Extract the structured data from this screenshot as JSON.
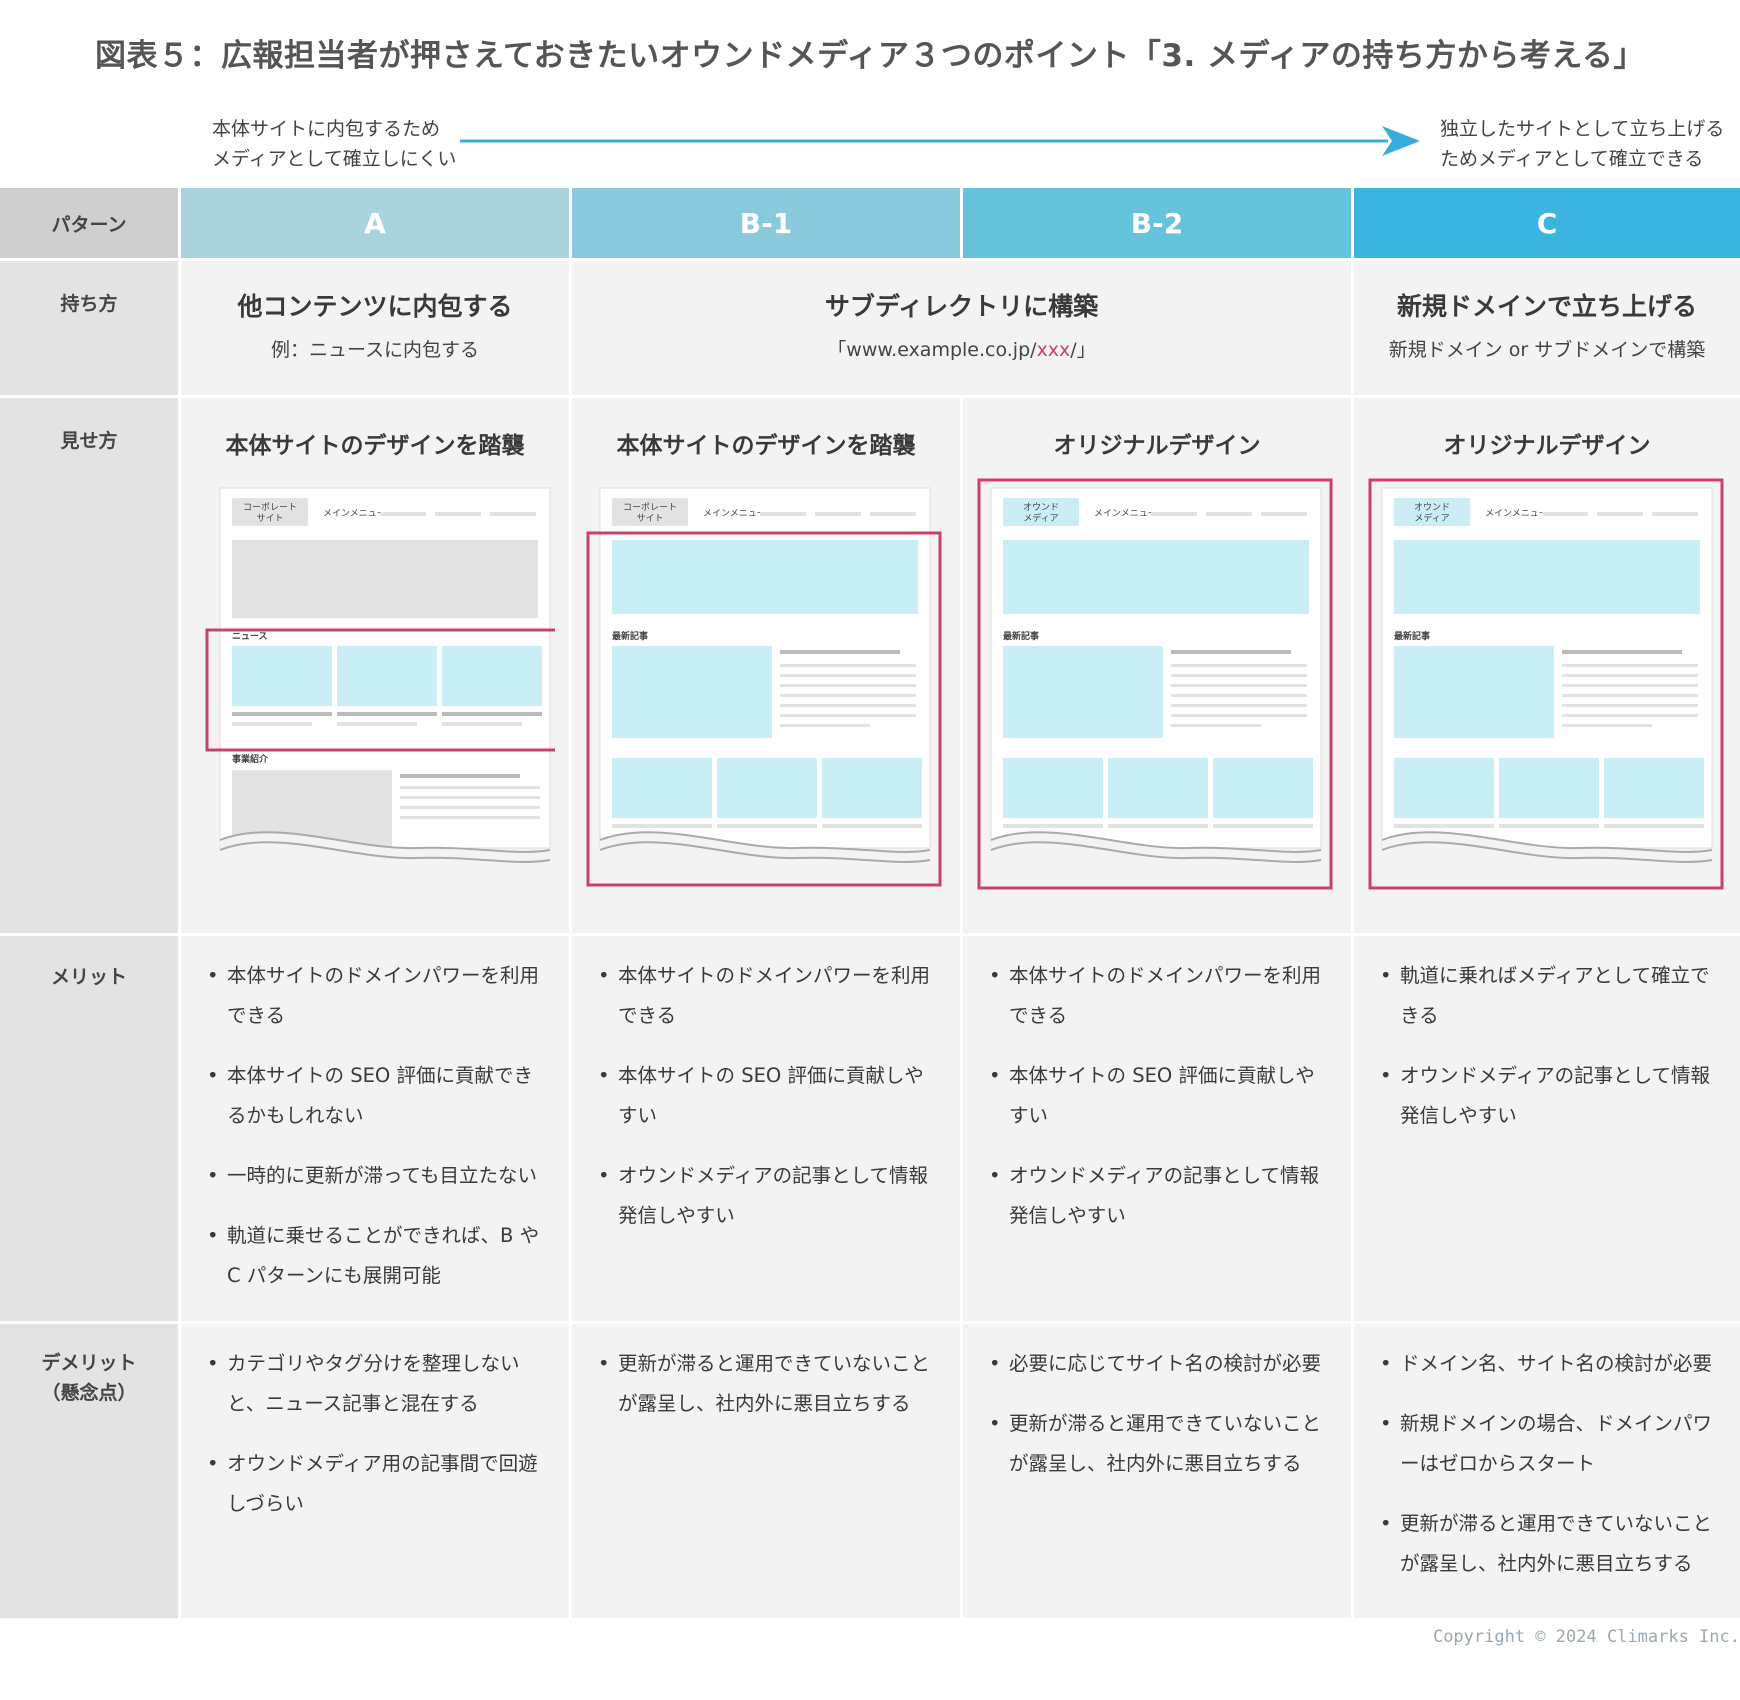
{
  "title": "図表５：広報担当者が押さえておきたいオウンドメディア３つのポイント「3. メディアの持ち方から考える」",
  "scale": {
    "left": [
      "本体サイトに内包するため",
      "メディアとして確立しにくい"
    ],
    "right": [
      "独立したサイトとして立ち上げる",
      "ためメディアとして確立できる"
    ]
  },
  "row_labels": {
    "pattern": "パターン",
    "holding": "持ち方",
    "appearance": "見せ方",
    "merit": "メリット",
    "demerit": [
      "デメリット",
      "（懸念点）"
    ]
  },
  "columns": [
    {
      "id": "A",
      "color": "#a8d2dc"
    },
    {
      "id": "B-1",
      "color": "#89cbdc"
    },
    {
      "id": "B-2",
      "color": "#66c3dc"
    },
    {
      "id": "C",
      "color": "#3bb4e0"
    }
  ],
  "holding": {
    "a": {
      "title": "他コンテンツに内包する",
      "sub": "例：ニュースに内包する"
    },
    "b": {
      "title": "サブディレクトリに構築",
      "sub_prefix": "「www.example.co.jp/",
      "sub_red": "xxx",
      "sub_suffix": "/」"
    },
    "c": {
      "title": "新規ドメインで立ち上げる",
      "sub": "新規ドメイン or サブドメインで構築"
    }
  },
  "appearance": [
    "本体サイトのデザインを踏襲",
    "本体サイトのデザインを踏襲",
    "オリジナルデザイン",
    "オリジナルデザイン"
  ],
  "mockups": {
    "corp_site": [
      "コーポレート",
      "サイト"
    ],
    "owned_media": [
      "オウンド",
      "メディア"
    ],
    "main_menu": "メインメニュー",
    "news": "ニュース",
    "business": "事業紹介",
    "latest": "最新記事"
  },
  "merits": [
    [
      "本体サイトのドメインパワーを利用できる",
      "本体サイトの SEO 評価に貢献できるかもしれない",
      "一時的に更新が滞っても目立たない",
      "軌道に乗せることができれば、B や C パターンにも展開可能"
    ],
    [
      "本体サイトのドメインパワーを利用できる",
      "本体サイトの SEO 評価に貢献しやすい",
      "オウンドメディアの記事として情報発信しやすい"
    ],
    [
      "本体サイトのドメインパワーを利用できる",
      "本体サイトの SEO 評価に貢献しやすい",
      "オウンドメディアの記事として情報発信しやすい"
    ],
    [
      "軌道に乗ればメディアとして確立できる",
      "オウンドメディアの記事として情報発信しやすい"
    ]
  ],
  "demerits": [
    [
      "カテゴリやタグ分けを整理しないと、ニュース記事と混在する",
      "オウンドメディア用の記事間で回遊しづらい"
    ],
    [
      "更新が滞ると運用できていないことが露呈し、社内外に悪目立ちする"
    ],
    [
      "必要に応じてサイト名の検討が必要",
      "更新が滞ると運用できていないことが露呈し、社内外に悪目立ちする"
    ],
    [
      "ドメイン名、サイト名の検討が必要",
      "新規ドメインの場合、ドメインパワーはゼロからスタート",
      "更新が滞ると運用できていないことが露呈し、社内外に悪目立ちする"
    ]
  ],
  "colors": {
    "arrow": "#35aede",
    "highlight": "#c9406f",
    "mock_fill": "#c9eef5",
    "mock_gray": "#e3e3e3"
  },
  "copyright": "Copyright © 2024 Climarks Inc."
}
